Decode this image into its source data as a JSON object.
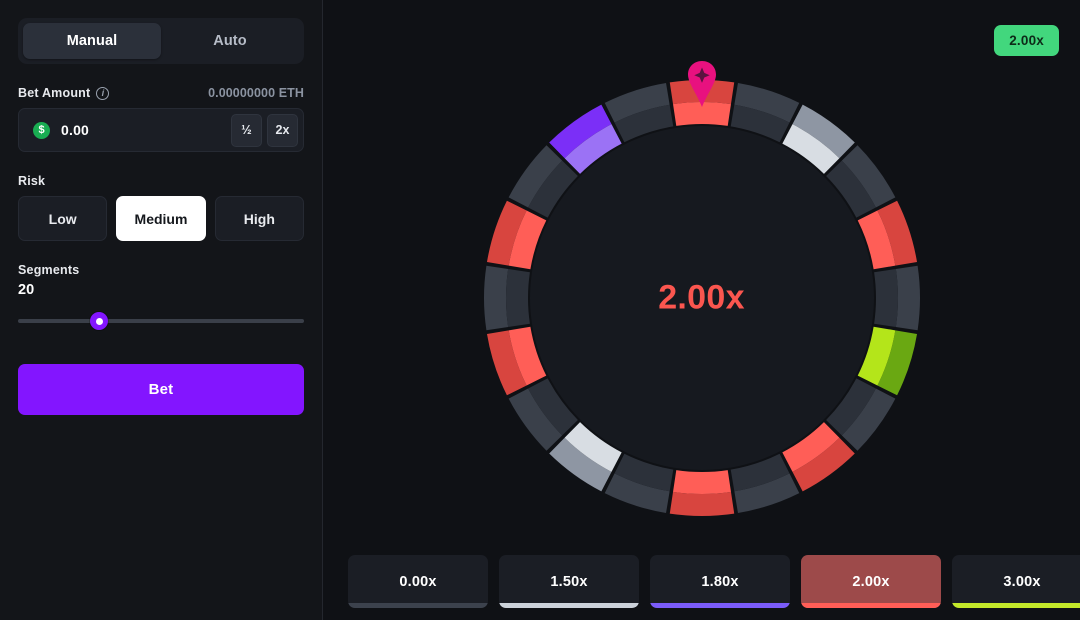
{
  "sidebar": {
    "tabs": [
      {
        "label": "Manual",
        "active": true
      },
      {
        "label": "Auto",
        "active": false
      }
    ],
    "bet_amount": {
      "label": "Bet Amount",
      "info_icon": "info-icon",
      "currency_value": "0.00000000 ETH",
      "coin_icon": "dollar-coin-icon",
      "value": "0.00",
      "half_label": "½",
      "double_label": "2x"
    },
    "risk": {
      "label": "Risk",
      "options": [
        {
          "label": "Low",
          "active": false
        },
        {
          "label": "Medium",
          "active": true
        },
        {
          "label": "High",
          "active": false
        }
      ]
    },
    "segments": {
      "label": "Segments",
      "value": "20",
      "slider_percent": 27
    },
    "bet_button": "Bet"
  },
  "game": {
    "badge": "2.00x",
    "center_multiplier": "2.00x",
    "pointer_icon": "wheel-pointer-pin-icon",
    "colors": {
      "red_inner": "#ff5e57",
      "red_outer": "#d8453f",
      "silver_inner": "#d8dde3",
      "silver_outer": "#8e96a3",
      "green_inner": "#b4e51a",
      "green_outer": "#6aa812",
      "purple_inner": "#9b72f5",
      "purple_outer": "#7b2ff7",
      "empty_inner": "#2c313a",
      "empty_outer": "#3a404a",
      "hub": "#16191f",
      "accent": "#8315ff",
      "badge_green": "#42d77d",
      "center_text": "#fb564f"
    },
    "wheel": {
      "segment_count": 20,
      "segments": [
        "red",
        "empty",
        "silver",
        "empty",
        "red",
        "empty",
        "green",
        "empty",
        "red",
        "empty",
        "red",
        "empty",
        "silver",
        "empty",
        "red",
        "empty",
        "red",
        "empty",
        "purple",
        "empty"
      ]
    },
    "multiplier_cards": [
      {
        "label": "0.00x",
        "color": "#3c424d",
        "hit": false
      },
      {
        "label": "1.50x",
        "color": "#ccd2da",
        "hit": false
      },
      {
        "label": "1.80x",
        "color": "#7b5cfa",
        "hit": false
      },
      {
        "label": "2.00x",
        "color": "#ff5e57",
        "hit": true
      },
      {
        "label": "3.00x",
        "color": "#c3e82a",
        "hit": false
      },
      {
        "label": "",
        "color": "#8315ff",
        "hit": false
      }
    ]
  }
}
